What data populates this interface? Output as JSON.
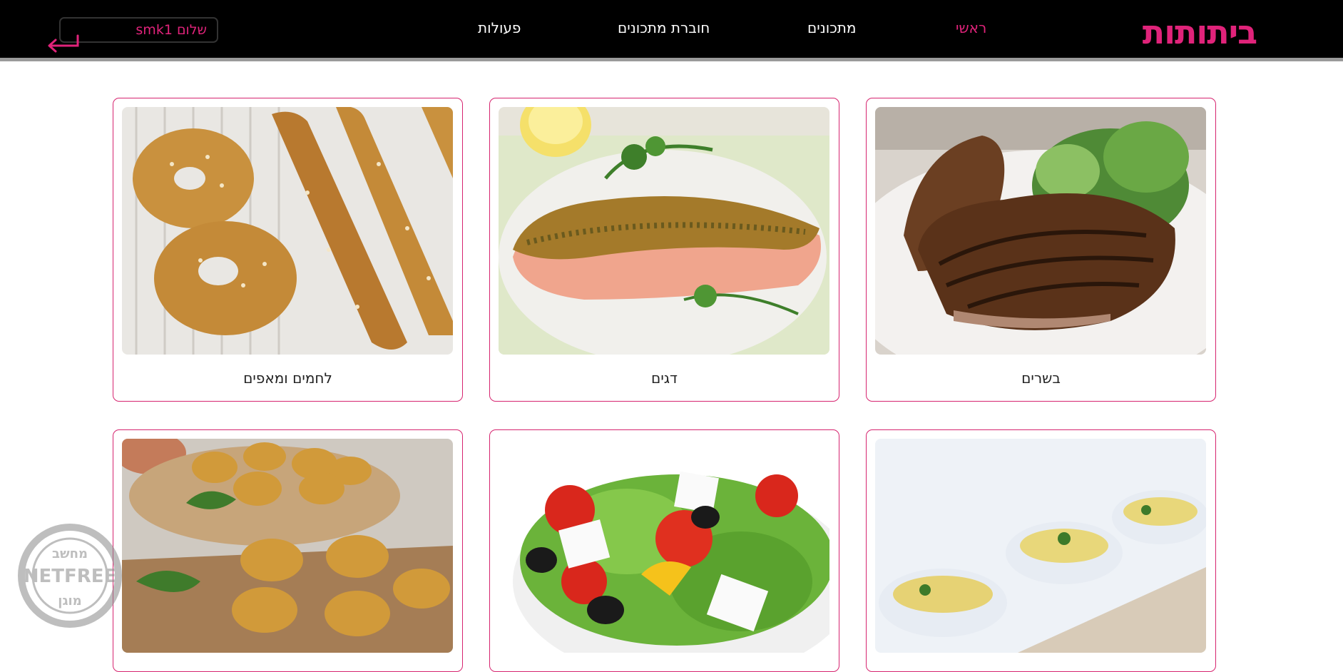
{
  "header": {
    "logo_text": "ביתותות",
    "nav": {
      "home": "ראשי",
      "recipes": "מתכונים",
      "booklet": "חוברת מתכונים",
      "actions": "פעולות"
    },
    "greeting": "שלום smk1"
  },
  "categories": [
    {
      "title": "בשרים",
      "image": "grilled-steak"
    },
    {
      "title": "דגים",
      "image": "crusted-salmon"
    },
    {
      "title": "לחמים ומאפים",
      "image": "sesame-bagels"
    },
    {
      "title": "",
      "image": "cream-soup-bowls"
    },
    {
      "title": "",
      "image": "greek-salad"
    },
    {
      "title": "",
      "image": "vegetable-muffins"
    }
  ],
  "watermark": {
    "line1": "מחשב",
    "line2": "NETFREE",
    "line3": "מוגן"
  },
  "colors": {
    "accent": "#e0237a",
    "header_bg": "#000000",
    "card_border": "#d6246f"
  }
}
